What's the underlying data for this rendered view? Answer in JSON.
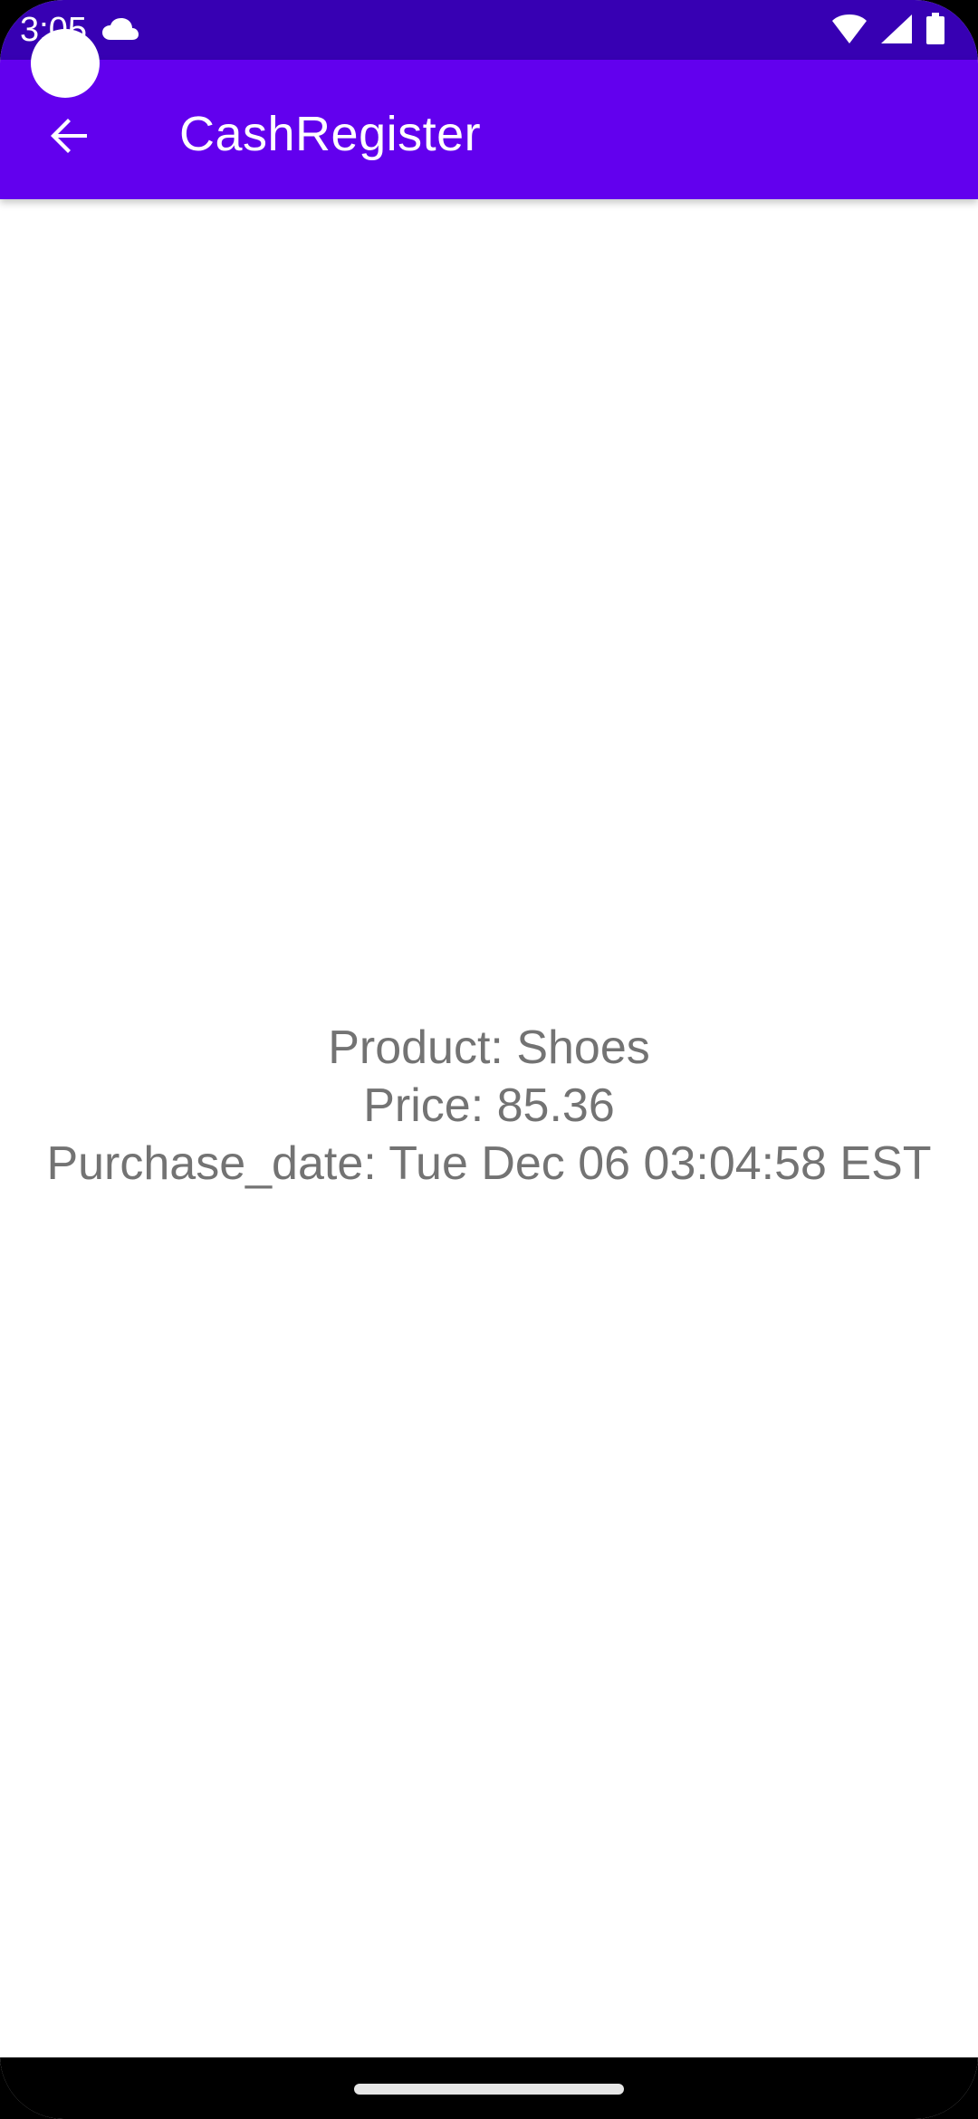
{
  "status_bar": {
    "time": "3:05",
    "icons": [
      "cloud-icon",
      "wifi-icon",
      "signal-icon",
      "battery-icon"
    ]
  },
  "app_bar": {
    "title": "CashRegister",
    "back_icon": "arrow-back-icon"
  },
  "purchase": {
    "product": "Product: Shoes",
    "price": "Price: 85.36",
    "purchase_date": "Purchase_date: Tue Dec 06 03:04:58 EST"
  },
  "colors": {
    "status_bar": "#3700b3",
    "app_bar": "#6200ee",
    "text": "#737373",
    "background": "#ffffff"
  }
}
